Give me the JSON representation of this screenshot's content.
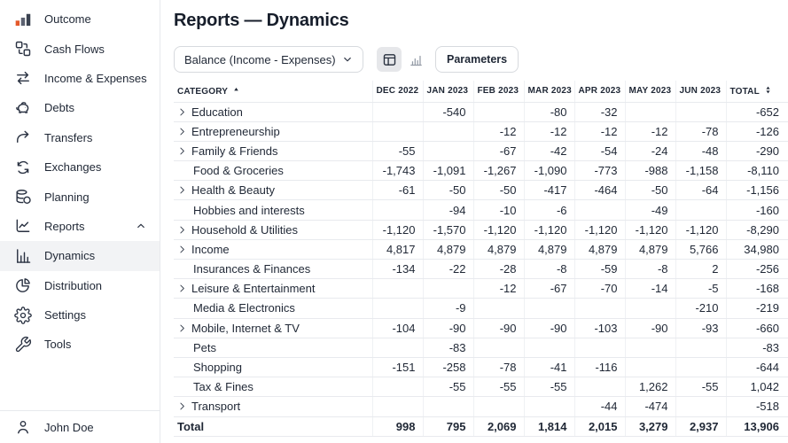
{
  "sidebar": {
    "items": [
      {
        "label": "Outcome",
        "icon": "outcome-logo",
        "active": false
      },
      {
        "label": "Cash Flows",
        "icon": "cash-flows",
        "active": false
      },
      {
        "label": "Income & Expenses",
        "icon": "arrows-left-right",
        "active": false
      },
      {
        "label": "Debts",
        "icon": "piggy-bank",
        "active": false
      },
      {
        "label": "Transfers",
        "icon": "arrow-curve-right",
        "active": false
      },
      {
        "label": "Exchanges",
        "icon": "cycle-arrows",
        "active": false
      },
      {
        "label": "Planning",
        "icon": "coins-stack",
        "active": false
      },
      {
        "label": "Reports",
        "icon": "line-chart",
        "active": false,
        "expanded": true
      },
      {
        "label": "Dynamics",
        "icon": "bar-chart-axis",
        "active": true
      },
      {
        "label": "Distribution",
        "icon": "pie-chart",
        "active": false
      },
      {
        "label": "Settings",
        "icon": "gear",
        "active": false
      },
      {
        "label": "Tools",
        "icon": "wrench",
        "active": false
      }
    ],
    "user": {
      "name": "John Doe"
    }
  },
  "header": {
    "title": "Reports — Dynamics"
  },
  "toolbar": {
    "metric_select_value": "Balance (Income - Expenses)",
    "parameters_label": "Parameters"
  },
  "table": {
    "columns": [
      {
        "label": "CATEGORY",
        "sort": "asc"
      },
      {
        "label": "DEC 2022"
      },
      {
        "label": "JAN 2023"
      },
      {
        "label": "FEB 2023"
      },
      {
        "label": "MAR 2023"
      },
      {
        "label": "APR 2023"
      },
      {
        "label": "MAY 2023"
      },
      {
        "label": "JUN 2023"
      },
      {
        "label": "TOTAL",
        "sort": "both"
      }
    ],
    "rows": [
      {
        "category": "Education",
        "expandable": true,
        "values": [
          "",
          "-540",
          "",
          "-80",
          "-32",
          "",
          "",
          "-652"
        ]
      },
      {
        "category": "Entrepreneurship",
        "expandable": true,
        "values": [
          "",
          "",
          "-12",
          "-12",
          "-12",
          "-12",
          "-78",
          "-126"
        ]
      },
      {
        "category": "Family & Friends",
        "expandable": true,
        "values": [
          "-55",
          "",
          "-67",
          "-42",
          "-54",
          "-24",
          "-48",
          "-290"
        ]
      },
      {
        "category": "Food & Groceries",
        "expandable": false,
        "values": [
          "-1,743",
          "-1,091",
          "-1,267",
          "-1,090",
          "-773",
          "-988",
          "-1,158",
          "-8,110"
        ]
      },
      {
        "category": "Health & Beauty",
        "expandable": true,
        "values": [
          "-61",
          "-50",
          "-50",
          "-417",
          "-464",
          "-50",
          "-64",
          "-1,156"
        ]
      },
      {
        "category": "Hobbies and interests",
        "expandable": false,
        "values": [
          "",
          "-94",
          "-10",
          "-6",
          "",
          "-49",
          "",
          "-160"
        ]
      },
      {
        "category": "Household & Utilities",
        "expandable": true,
        "values": [
          "-1,120",
          "-1,570",
          "-1,120",
          "-1,120",
          "-1,120",
          "-1,120",
          "-1,120",
          "-8,290"
        ]
      },
      {
        "category": "Income",
        "expandable": true,
        "values": [
          "4,817",
          "4,879",
          "4,879",
          "4,879",
          "4,879",
          "4,879",
          "5,766",
          "34,980"
        ]
      },
      {
        "category": "Insurances & Finances",
        "expandable": false,
        "values": [
          "-134",
          "-22",
          "-28",
          "-8",
          "-59",
          "-8",
          "2",
          "-256"
        ]
      },
      {
        "category": "Leisure & Entertainment",
        "expandable": true,
        "values": [
          "",
          "",
          "-12",
          "-67",
          "-70",
          "-14",
          "-5",
          "-168"
        ]
      },
      {
        "category": "Media & Electronics",
        "expandable": false,
        "values": [
          "",
          "-9",
          "",
          "",
          "",
          "",
          "-210",
          "-219"
        ]
      },
      {
        "category": "Mobile, Internet & TV",
        "expandable": true,
        "values": [
          "-104",
          "-90",
          "-90",
          "-90",
          "-103",
          "-90",
          "-93",
          "-660"
        ]
      },
      {
        "category": "Pets",
        "expandable": false,
        "values": [
          "",
          "-83",
          "",
          "",
          "",
          "",
          "",
          "-83"
        ]
      },
      {
        "category": "Shopping",
        "expandable": false,
        "values": [
          "-151",
          "-258",
          "-78",
          "-41",
          "-116",
          "",
          "",
          "-644"
        ]
      },
      {
        "category": "Tax & Fines",
        "expandable": false,
        "values": [
          "",
          "-55",
          "-55",
          "-55",
          "",
          "1,262",
          "-55",
          "1,042"
        ]
      },
      {
        "category": "Transport",
        "expandable": true,
        "values": [
          "",
          "",
          "",
          "",
          "-44",
          "-474",
          "",
          "-518"
        ]
      }
    ],
    "total": {
      "label": "Total",
      "values": [
        "998",
        "795",
        "2,069",
        "1,814",
        "2,015",
        "3,279",
        "2,937",
        "13,906"
      ]
    }
  }
}
